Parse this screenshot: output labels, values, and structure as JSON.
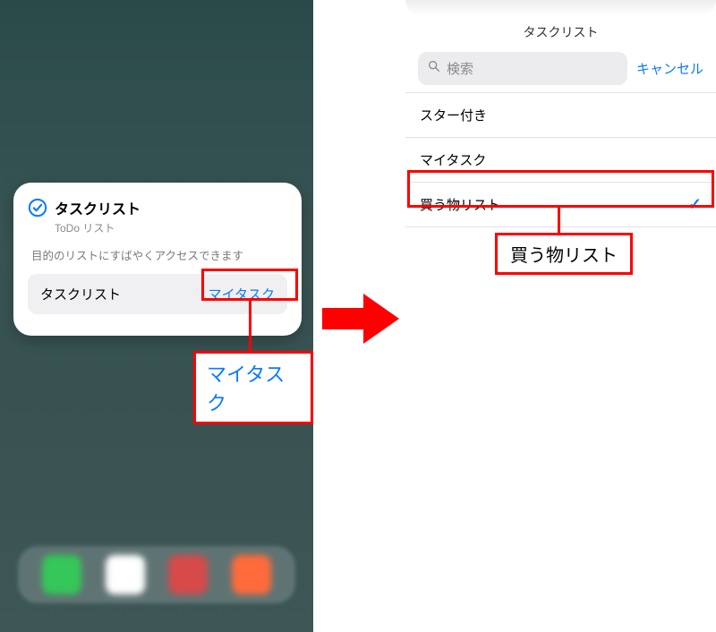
{
  "left": {
    "widget": {
      "icon_name": "checkmark-circle-icon",
      "title": "タスクリスト",
      "subtitle": "ToDo リスト",
      "description": "目的のリストにすばやくアクセスできます",
      "row_label": "タスクリスト",
      "row_value": "マイタスク"
    },
    "callout": "マイタスク"
  },
  "right": {
    "sheet_title": "タスクリスト",
    "search_placeholder": "検索",
    "cancel_label": "キャンセル",
    "items": [
      {
        "label": "スター付き",
        "selected": false
      },
      {
        "label": "マイタスク",
        "selected": false
      },
      {
        "label": "買う物リスト",
        "selected": true
      }
    ],
    "callout": "買う物リスト"
  },
  "colors": {
    "accent": "#0a7aff",
    "highlight": "#ff0000"
  }
}
